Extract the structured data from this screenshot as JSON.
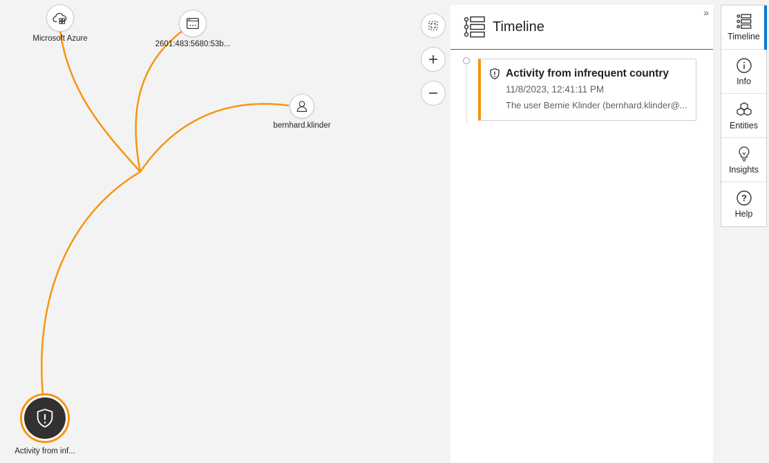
{
  "graph": {
    "nodes": {
      "azure": {
        "label": "Microsoft Azure",
        "icon": "cloud-app-icon"
      },
      "ip": {
        "label": "2601:483:5680:53b...",
        "icon": "ip-address-icon"
      },
      "user": {
        "label": "bernhard.klinder",
        "icon": "user-icon"
      },
      "alert": {
        "label": "Activity from inf...",
        "icon": "alert-shield-icon"
      }
    },
    "edge_color": "#f7940e",
    "controls": {
      "fit": "fit-to-screen-icon",
      "zoom_in": "zoom-in-icon",
      "zoom_out": "zoom-out-icon"
    }
  },
  "panel": {
    "title": "Timeline",
    "collapse_glyph": "»",
    "items": [
      {
        "title": "Activity from infrequent country",
        "time": "11/8/2023, 12:41:11 PM",
        "description": "The user Bernie Klinder (bernhard.klinder@...",
        "accent": "#f7940e"
      }
    ]
  },
  "tabs": [
    {
      "label": "Timeline",
      "icon": "timeline-icon",
      "active": true
    },
    {
      "label": "Info",
      "icon": "info-icon"
    },
    {
      "label": "Entities",
      "icon": "entities-icon"
    },
    {
      "label": "Insights",
      "icon": "lightbulb-icon"
    },
    {
      "label": "Help",
      "icon": "help-icon"
    }
  ],
  "colors": {
    "active_tab": "#0078d4",
    "alert": "#f7940e"
  }
}
